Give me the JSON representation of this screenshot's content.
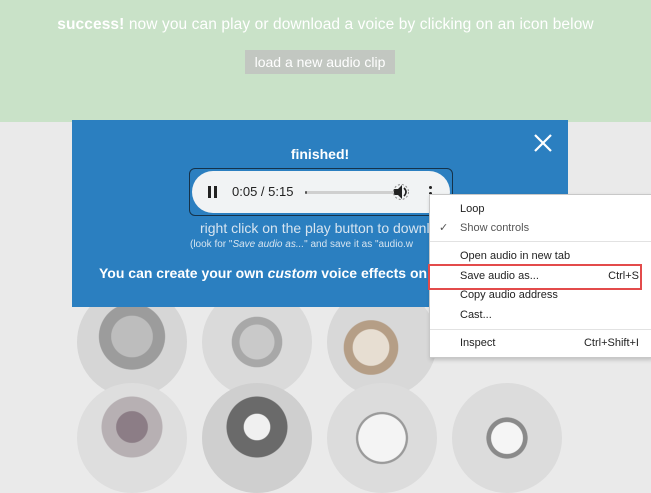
{
  "banner": {
    "strong": "success!",
    "message": " now you can play or download a voice by clicking on an icon below",
    "load_button": "load a new audio clip"
  },
  "modal": {
    "title": "finished!",
    "player": {
      "time": "0:05 / 5:15",
      "progress": 0.016
    },
    "line1": "right click on the play button to downlo",
    "line2_prefix": "(look for \"",
    "line2_em": "Save audio as...",
    "line2_suffix": "\" and save it as \"audio.w",
    "line3_prefix": "You can create your own ",
    "line3_em": "custom",
    "line3_suffix": " voice effects on the"
  },
  "context_menu": {
    "items": [
      {
        "label": "Loop",
        "shortcut": ""
      },
      {
        "label": "Show controls",
        "shortcut": "",
        "checked": true
      },
      {
        "label": "Open audio in new tab",
        "shortcut": ""
      },
      {
        "label": "Save audio as...",
        "shortcut": "Ctrl+S",
        "highlighted": true
      },
      {
        "label": "Copy audio address",
        "shortcut": ""
      },
      {
        "label": "Cast...",
        "shortcut": ""
      },
      {
        "label": "Inspect",
        "shortcut": "Ctrl+Shift+I"
      }
    ],
    "checkmark": "✓"
  },
  "colors": {
    "banner_bg": "#c9e2c8",
    "modal_bg": "#2b7fc0",
    "highlight_border": "#e34b4b"
  }
}
